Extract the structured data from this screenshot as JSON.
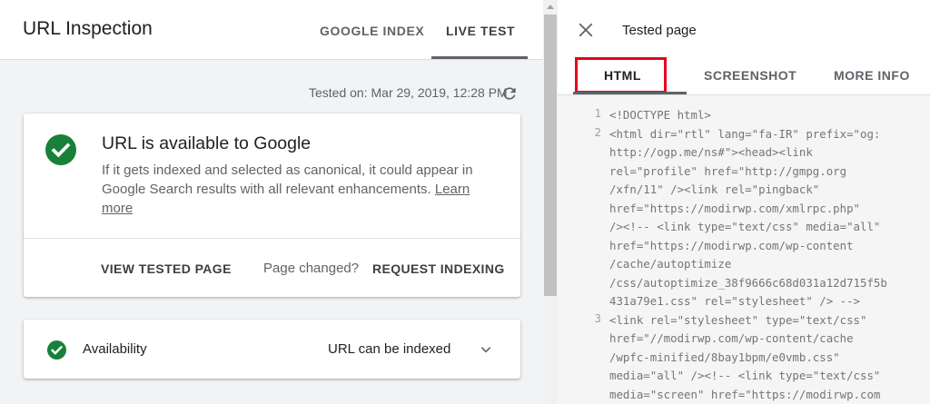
{
  "header": {
    "title": "URL Inspection",
    "tabs": [
      "GOOGLE INDEX",
      "LIVE TEST"
    ],
    "active_tab": "LIVE TEST"
  },
  "tested_on": "Tested on: Mar 29, 2019, 12:28 PM",
  "main_card": {
    "title": "URL is available to Google",
    "description": "If it gets indexed and selected as canonical, it could appear in Google Search results with all relevant enhancements.",
    "learn_more": "Learn more",
    "view_tested_page": "VIEW TESTED PAGE",
    "page_changed": "Page changed?",
    "request_indexing": "REQUEST INDEXING"
  },
  "availability_card": {
    "label": "Availability",
    "status": "URL can be indexed"
  },
  "right_panel": {
    "title": "Tested page",
    "tabs": [
      "HTML",
      "SCREENSHOT",
      "MORE INFO"
    ],
    "active_tab": "HTML",
    "code_lines": [
      {
        "num": "1",
        "text": "<!DOCTYPE html>"
      },
      {
        "num": "2",
        "text": "<html dir=\"rtl\" lang=\"fa-IR\" prefix=\"og:\nhttp://ogp.me/ns#\"><head><link\nrel=\"profile\" href=\"http://gmpg.org\n/xfn/11\" /><link rel=\"pingback\"\nhref=\"https://modirwp.com/xmlrpc.php\"\n/><!-- <link type=\"text/css\" media=\"all\"\nhref=\"https://modirwp.com/wp-content\n/cache/autoptimize\n/css/autoptimize_38f9666c68d031a12d715f5b\n431a79e1.css\" rel=\"stylesheet\" /> -->"
      },
      {
        "num": "3",
        "text": "<link rel=\"stylesheet\" type=\"text/css\"\nhref=\"//modirwp.com/wp-content/cache\n/wpfc-minified/8bay1bpm/e0vmb.css\"\nmedia=\"all\" /><!-- <link type=\"text/css\"\nmedia=\"screen\" href=\"https://modirwp.com"
      }
    ]
  },
  "colors": {
    "check_green": "#188038",
    "highlight_red": "#e8001c",
    "panel_bg": "#f1f3f4",
    "code_bg": "#f5f5f5"
  },
  "icons": [
    "refresh-icon",
    "check-circle-icon",
    "chevron-down-icon",
    "close-icon"
  ]
}
